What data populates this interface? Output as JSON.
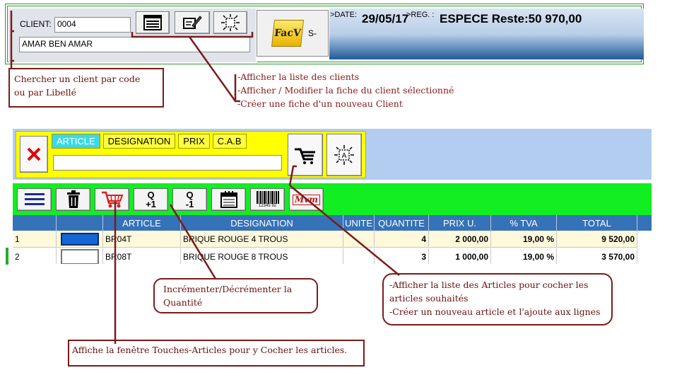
{
  "client": {
    "code_label": "CLIENT:",
    "code_value": "0004",
    "name_value": "AMAR BEN AMAR"
  },
  "invoice": {
    "facv_label": "FacV",
    "facv_suffix": "S-",
    "date_label": ">DATE:",
    "date_value": "29/05/17",
    "reg_label": ">REG. :",
    "reg_value": "ESPECE Reste:50  970,00"
  },
  "notes": {
    "search_client": [
      "Chercher un client par code",
      "ou par Libellé"
    ],
    "client_buttons": [
      "-Afficher la liste des clients",
      "-Afficher / Modifier la fiche du client sélectionné",
      "-Créer une fiche d'un nouveau Client"
    ],
    "quantity": [
      "Incrémenter/Décrémenter la",
      "Quantité"
    ],
    "articles_list": [
      "-Afficher la liste des Articles pour cocher les",
      "articles souhaités",
      "-Créer un nouveau article et l'ajoute aux lignes"
    ],
    "touches_articles": "Affiche la fenêtre Touches-Articles pour y Cocher les articles."
  },
  "search": {
    "tabs": [
      "ARTICLE",
      "DESIGNATION",
      "PRIX",
      "C.A.B"
    ],
    "input_value": ""
  },
  "toolbar": {
    "qty_plus": [
      "Q",
      "+1"
    ],
    "qty_minus": [
      "Q",
      "-1"
    ],
    "barcode_digits": "12345 92",
    "mvm_label": "Mvm"
  },
  "table": {
    "columns": [
      "ARTICLE",
      "DESIGNATION",
      "UNITE",
      "QUANTITE",
      "PRIX U.",
      "% TVA",
      "TOTAL"
    ],
    "rows": [
      {
        "num": "1",
        "article": "BR04T",
        "designation": "BRIQUE ROUGE 4 TROUS",
        "unite": "",
        "quantite": "4",
        "prix": "2 000,00",
        "tva": "19,00 %",
        "total": "9 520,00"
      },
      {
        "num": "2",
        "article": "BR08T",
        "designation": "BRIQUE ROUGE 8 TROUS",
        "unite": "",
        "quantite": "3",
        "prix": "1 000,00",
        "tva": "19,00 %",
        "total": "3 570,00"
      }
    ]
  },
  "colors": {
    "annotation": "#7b1b1b",
    "toolbar_green": "#11ee22",
    "search_yellow": "#ffff00",
    "grid_header": "#3572b8"
  }
}
